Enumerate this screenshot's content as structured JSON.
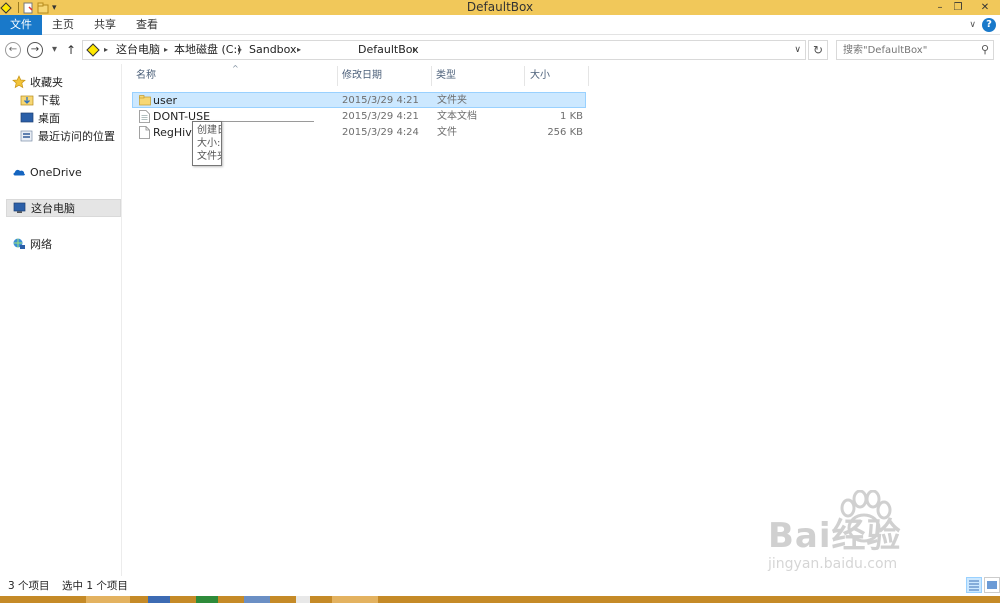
{
  "window": {
    "title": "DefaultBox",
    "minimize_glyph": "–",
    "restore_glyph": "❐",
    "close_glyph": "✕"
  },
  "ribbon": {
    "tabs": [
      "文件",
      "主页",
      "共享",
      "查看"
    ],
    "expand_glyph": "∨",
    "help_glyph": "?"
  },
  "navigation": {
    "back_glyph": "←",
    "forward_glyph": "→",
    "recent_glyph": "▾",
    "up_glyph": "↑",
    "breadcrumb": [
      "这台电脑",
      "本地磁盘 (C:)",
      "Sandbox",
      "DefaultBox"
    ],
    "refresh_glyph": "↻",
    "search_placeholder": "搜索\"DefaultBox\"",
    "search_glyph": "⚲"
  },
  "sidebar": {
    "items": [
      {
        "label": "收藏夹",
        "icon": "star-icon"
      },
      {
        "label": "下载",
        "icon": "downloads-folder-icon"
      },
      {
        "label": "桌面",
        "icon": "desktop-icon"
      },
      {
        "label": "最近访问的位置",
        "icon": "recent-places-icon"
      },
      {
        "label": "OneDrive",
        "icon": "cloud-icon"
      },
      {
        "label": "这台电脑",
        "icon": "computer-icon"
      },
      {
        "label": "网络",
        "icon": "network-icon"
      }
    ]
  },
  "file_list": {
    "columns": [
      "名称",
      "修改日期",
      "类型",
      "大小"
    ],
    "sort_glyph": "^",
    "rows": [
      {
        "name": "user",
        "date": "2015/3/29 4:21",
        "type": "文件夹",
        "size": "",
        "icon": "folder-icon",
        "selected": true
      },
      {
        "name": "DONT-USE",
        "date": "2015/3/29 4:21",
        "type": "文本文档",
        "size": "1 KB",
        "icon": "text-file-icon",
        "selected": false
      },
      {
        "name": "RegHive",
        "date": "2015/3/29 4:24",
        "type": "文件",
        "size": "256 KB",
        "icon": "file-icon",
        "selected": false
      }
    ]
  },
  "tooltip": {
    "lines": [
      "创建日",
      "大小:",
      "文件夹"
    ]
  },
  "status_bar": {
    "item_count": "3 个项目",
    "selection": "选中 1 个项目"
  },
  "watermark": {
    "brand": "Bai经验",
    "url": "jingyan.baidu.com"
  },
  "colors": {
    "title_bar": "#f1c85a",
    "file_tab": "#1979ca",
    "selection_fill": "#cce8ff",
    "selection_border": "#99d1ff",
    "taskbar": "#c58a27"
  }
}
